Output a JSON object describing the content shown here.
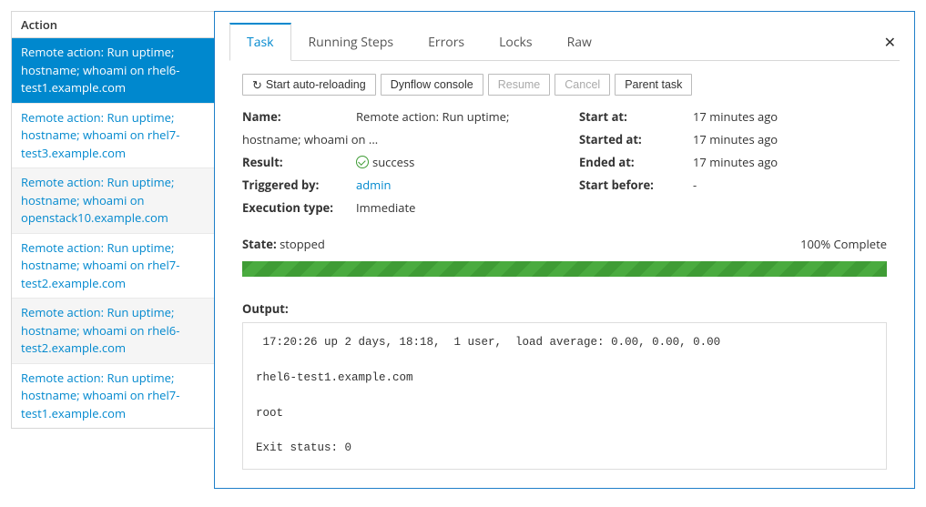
{
  "sidebar": {
    "header": "Action",
    "items": [
      {
        "text": "Remote action: Run uptime; hostname; whoami on rhel6-test1.example.com",
        "selected": true
      },
      {
        "text": "Remote action: Run uptime; hostname; whoami on rhel7-test3.example.com",
        "alt": false
      },
      {
        "text": "Remote action: Run uptime; hostname; whoami on openstack10.example.com",
        "alt": true
      },
      {
        "text": "Remote action: Run uptime; hostname; whoami on rhel7-test2.example.com",
        "alt": false
      },
      {
        "text": "Remote action: Run uptime; hostname; whoami on rhel6-test2.example.com",
        "alt": true
      },
      {
        "text": "Remote action: Run uptime; hostname; whoami on rhel7-test1.example.com",
        "alt": false
      }
    ]
  },
  "tabs": [
    "Task",
    "Running Steps",
    "Errors",
    "Locks",
    "Raw"
  ],
  "active_tab": 0,
  "toolbar": {
    "auto_reload": "Start auto-reloading",
    "dynflow": "Dynflow console",
    "resume": "Resume",
    "cancel": "Cancel",
    "parent": "Parent task"
  },
  "details": {
    "name_label": "Name:",
    "name_value": "Remote action: Run uptime;",
    "name_value_2": "hostname; whoami on ...",
    "result_label": "Result:",
    "result_value": "success",
    "triggered_label": "Triggered by:",
    "triggered_value": "admin",
    "exec_label": "Execution type:",
    "exec_value": "Immediate",
    "start_at_label": "Start at:",
    "start_at_value": "17 minutes ago",
    "started_at_label": "Started at:",
    "started_at_value": "17 minutes ago",
    "ended_at_label": "Ended at:",
    "ended_at_value": "17 minutes ago",
    "start_before_label": "Start before:",
    "start_before_value": "-"
  },
  "state": {
    "label": "State:",
    "value": "stopped",
    "complete": "100% Complete"
  },
  "output": {
    "label": "Output:",
    "text": " 17:20:26 up 2 days, 18:18,  1 user,  load average: 0.00, 0.00, 0.00\n\nrhel6-test1.example.com\n\nroot\n\nExit status: 0"
  }
}
